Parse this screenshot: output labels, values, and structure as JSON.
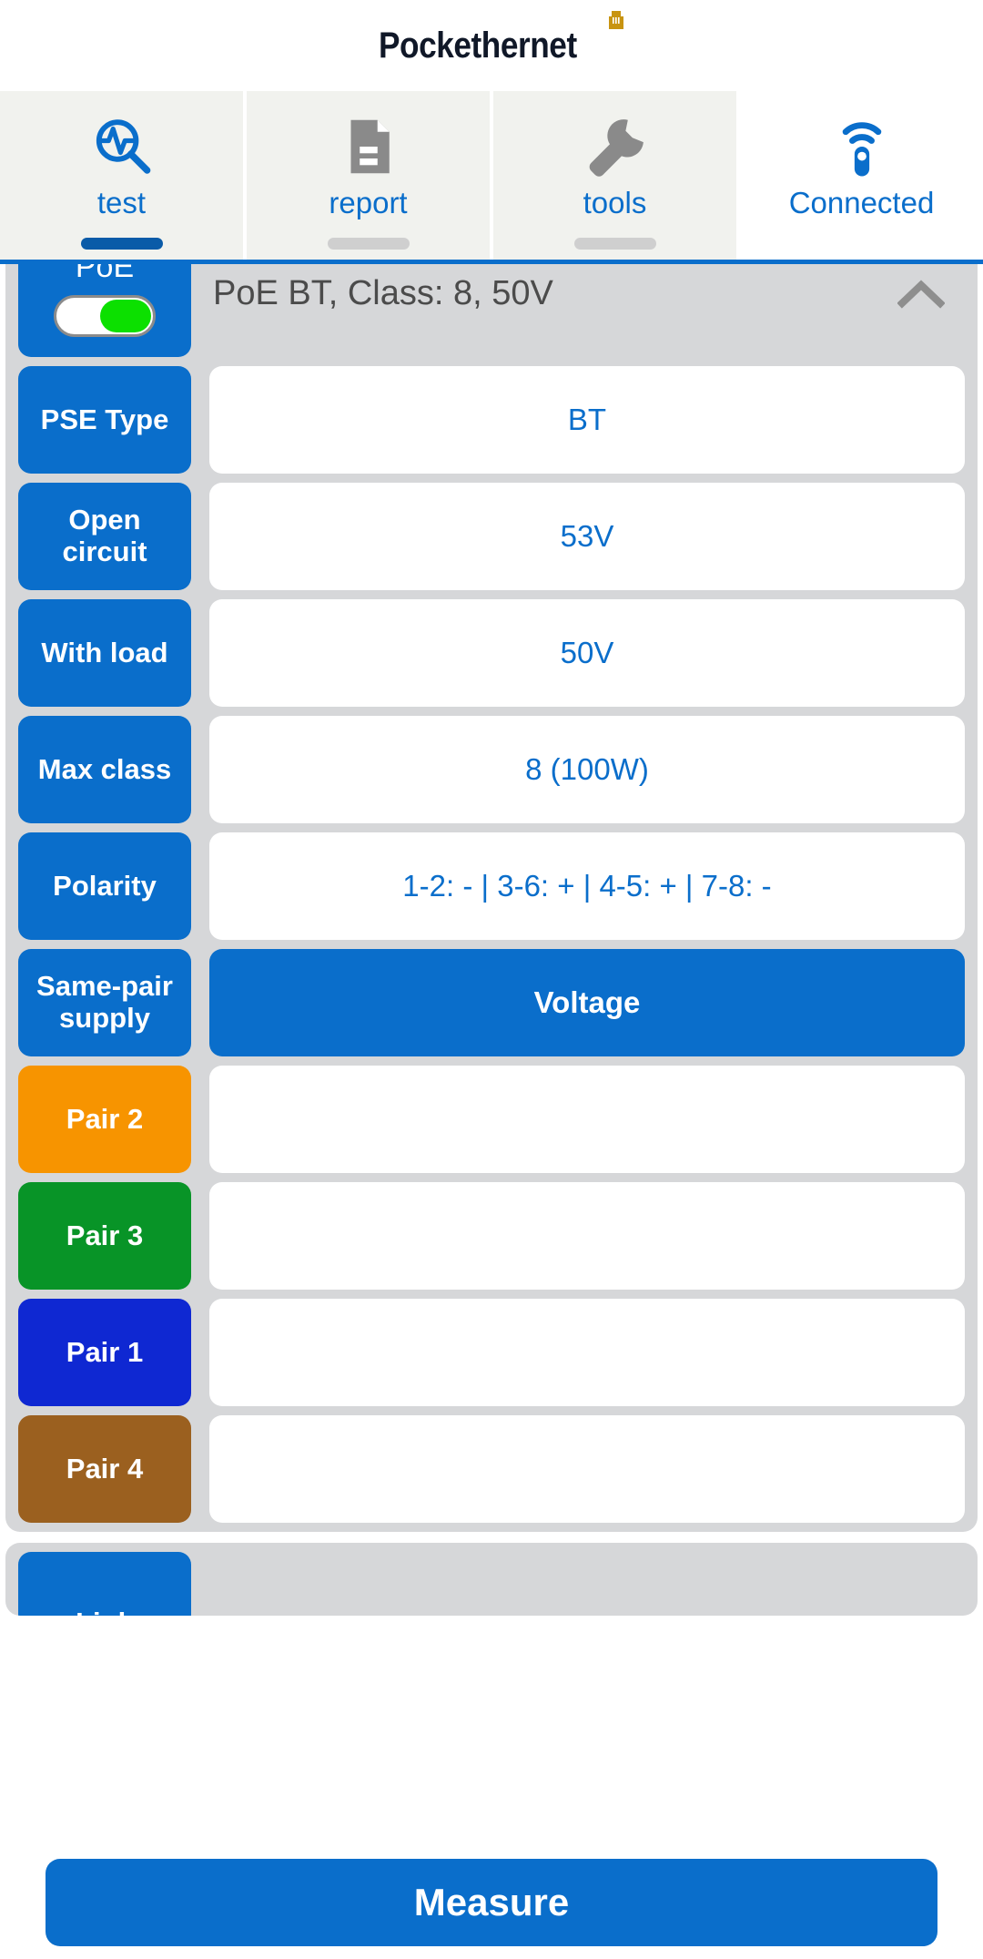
{
  "brand": {
    "wordmark": "Pockethernet",
    "jack_icon": "rj45-jack-icon",
    "jack_color": "#c89411"
  },
  "tabs": [
    {
      "label": "test",
      "icon": "test-scope-icon",
      "active": true,
      "icon_color": "#0a6ecb"
    },
    {
      "label": "report",
      "icon": "document-icon",
      "active": false,
      "icon_color": "#8a8a8a"
    },
    {
      "label": "tools",
      "icon": "wrench-icon",
      "active": false,
      "icon_color": "#8a8a8a"
    },
    {
      "label": "Connected",
      "icon": "device-signal-icon",
      "active": false,
      "icon_color": "#0a6ecb"
    }
  ],
  "poe_section": {
    "chip_label": "PoE",
    "toggle_state": "on",
    "toggle_on_color": "#0ce000",
    "summary": "PoE BT, Class: 8, 50V",
    "collapse_icon": "chevron-up-icon",
    "rows": [
      {
        "label": "PSE Type",
        "value": "BT",
        "label_color": "#0a6ecb",
        "style": "value"
      },
      {
        "label": "Open circuit",
        "value": "53V",
        "label_color": "#0a6ecb",
        "style": "value"
      },
      {
        "label": "With load",
        "value": "50V",
        "label_color": "#0a6ecb",
        "style": "value"
      },
      {
        "label": "Max class",
        "value": "8 (100W)",
        "label_color": "#0a6ecb",
        "style": "value"
      },
      {
        "label": "Polarity",
        "value": "1-2: - | 3-6: + | 4-5: + | 7-8: -",
        "label_color": "#0a6ecb",
        "style": "value"
      },
      {
        "label": "Same-pair supply",
        "value": "Voltage",
        "label_color": "#0a6ecb",
        "style": "header"
      },
      {
        "label": "Pair 2",
        "value": "",
        "label_color": "#f79400",
        "style": "empty"
      },
      {
        "label": "Pair 3",
        "value": "",
        "label_color": "#089427",
        "style": "empty"
      },
      {
        "label": "Pair 1",
        "value": "",
        "label_color": "#0f28d2",
        "style": "empty"
      },
      {
        "label": "Pair 4",
        "value": "",
        "label_color": "#9b601f",
        "style": "empty"
      }
    ]
  },
  "next_section": {
    "chip_label": "Link"
  },
  "footer": {
    "measure_label": "Measure"
  },
  "colors": {
    "brand_blue": "#0a6ecb",
    "card_gray": "#d6d7d9",
    "tab_gray": "#f1f2ee",
    "text_gray": "#4b4b4b"
  }
}
